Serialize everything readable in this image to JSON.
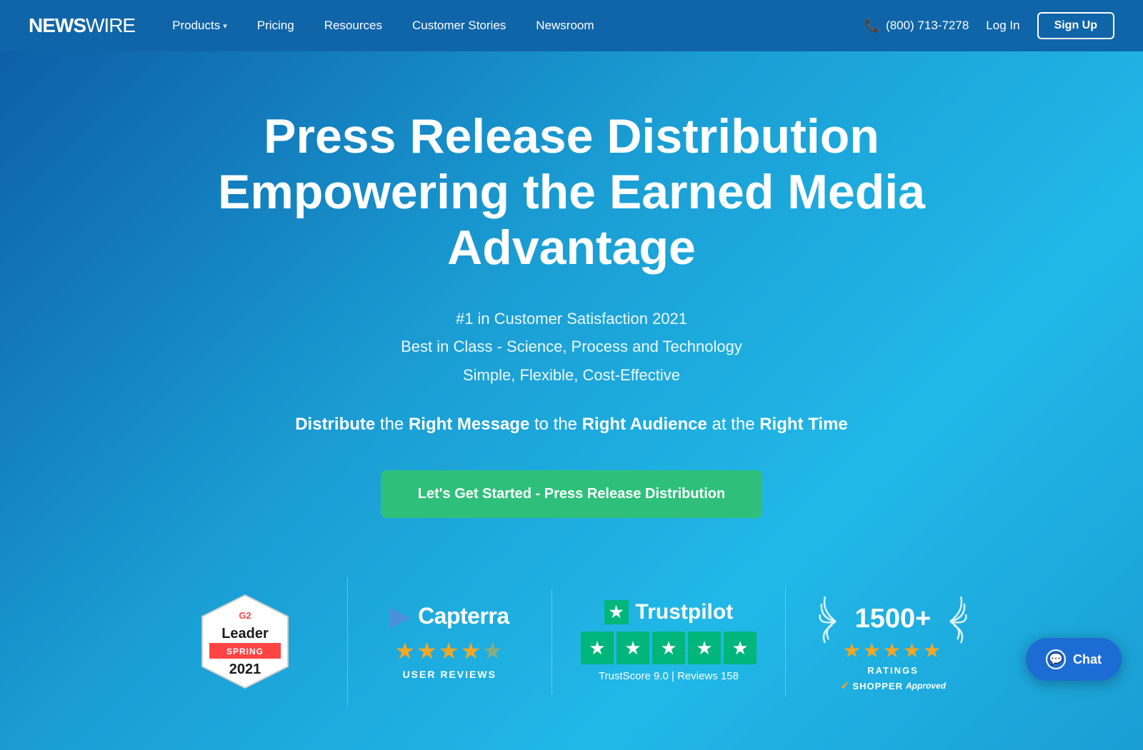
{
  "navbar": {
    "logo": {
      "bold": "NEWS",
      "light": "WIRE"
    },
    "nav_items": [
      {
        "id": "products",
        "label": "Products",
        "has_dropdown": true
      },
      {
        "id": "pricing",
        "label": "Pricing",
        "has_dropdown": false
      },
      {
        "id": "resources",
        "label": "Resources",
        "has_dropdown": false
      },
      {
        "id": "customer-stories",
        "label": "Customer Stories",
        "has_dropdown": false
      },
      {
        "id": "newsroom",
        "label": "Newsroom",
        "has_dropdown": false
      }
    ],
    "phone_icon": "📞",
    "phone": "(800) 713-7278",
    "login_label": "Log In",
    "signup_label": "Sign Up"
  },
  "hero": {
    "title_line1": "Press Release Distribution",
    "title_line2": "Empowering the Earned Media Advantage",
    "subtitle_line1": "#1 in Customer Satisfaction 2021",
    "subtitle_line2": "Best in Class - Science, Process and Technology",
    "subtitle_line3": "Simple, Flexible, Cost-Effective",
    "tagline": "Distribute the Right Message to the Right Audience at the Right Time",
    "cta_label": "Let's Get Started - Press Release Distribution"
  },
  "badges": {
    "g2": {
      "logo": "G2",
      "leader": "Leader",
      "season": "SPRING",
      "year": "2021"
    },
    "capterra": {
      "arrow": "▶",
      "name": "Capterra",
      "stars": "★★★★½",
      "label": "USER REVIEWS"
    },
    "trustpilot": {
      "name": "Trustpilot",
      "score_label": "TrustScore 9.0 | Reviews 158"
    },
    "shopper": {
      "count": "1500+",
      "stars": "★★★★★",
      "ratings_label": "RATINGS",
      "logo_check": "✓",
      "logo_name": "SHOPPER",
      "logo_approved": "Approved"
    }
  },
  "chat": {
    "label": "Chat",
    "icon": "💬"
  }
}
